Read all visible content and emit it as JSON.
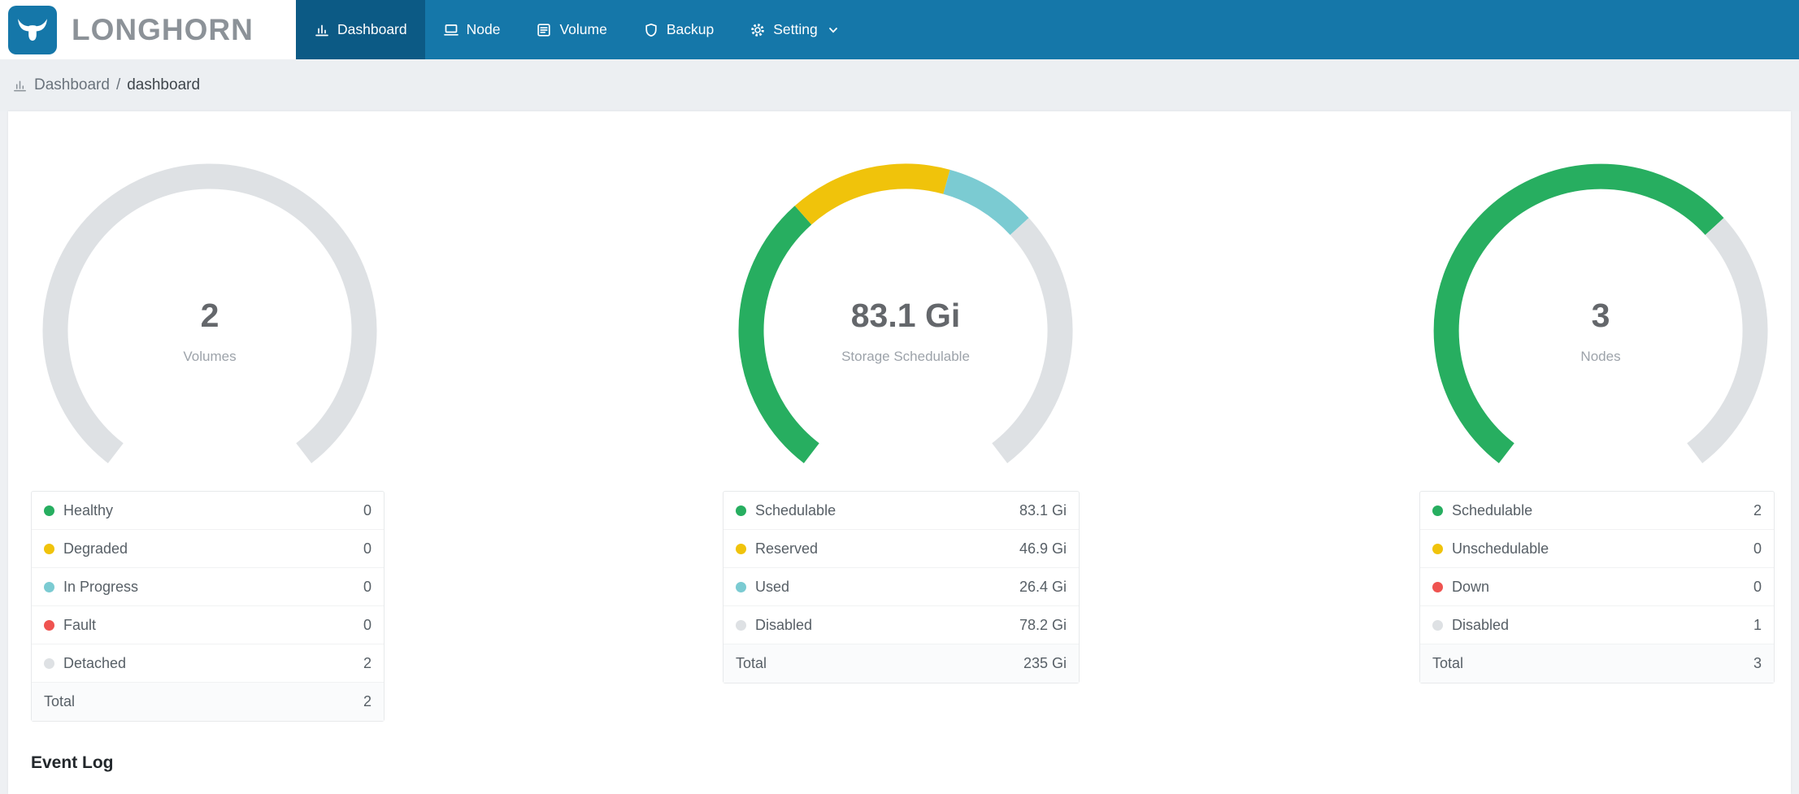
{
  "brand": {
    "name": "LONGHORN"
  },
  "colors": {
    "navbar": "#1577A9",
    "navbar_active": "#0C5A85",
    "green": "#27AE60",
    "yellow": "#F0C30B",
    "cyan": "#7BCBD2",
    "red": "#EF5350",
    "gray": "#DEE1E4"
  },
  "nav": {
    "items": [
      {
        "label": "Dashboard",
        "icon": "dashboard-icon",
        "active": true
      },
      {
        "label": "Node",
        "icon": "node-icon",
        "active": false
      },
      {
        "label": "Volume",
        "icon": "volume-icon",
        "active": false
      },
      {
        "label": "Backup",
        "icon": "backup-icon",
        "active": false
      },
      {
        "label": "Setting",
        "icon": "setting-icon",
        "active": false,
        "has_dropdown": true
      }
    ]
  },
  "breadcrumb": {
    "root": "Dashboard",
    "separator": "/",
    "current": "dashboard"
  },
  "chart_data": [
    {
      "type": "gauge",
      "title": "Volumes",
      "center_value": "2",
      "center_label": "Volumes",
      "arc_degrees": 285,
      "total": 2,
      "segments": [
        {
          "label": "Healthy",
          "value": 0,
          "color": "green"
        },
        {
          "label": "Degraded",
          "value": 0,
          "color": "yellow"
        },
        {
          "label": "In Progress",
          "value": 0,
          "color": "cyan"
        },
        {
          "label": "Fault",
          "value": 0,
          "color": "red"
        },
        {
          "label": "Detached",
          "value": 2,
          "color": "gray"
        }
      ]
    },
    {
      "type": "gauge",
      "title": "Storage Schedulable",
      "center_value": "83.1 Gi",
      "center_label": "Storage Schedulable",
      "arc_degrees": 285,
      "total": 235,
      "segments": [
        {
          "label": "Schedulable",
          "value": 83.1,
          "color": "green"
        },
        {
          "label": "Reserved",
          "value": 46.9,
          "color": "yellow"
        },
        {
          "label": "Used",
          "value": 26.4,
          "color": "cyan"
        },
        {
          "label": "Disabled",
          "value": 78.2,
          "color": "gray"
        }
      ]
    },
    {
      "type": "gauge",
      "title": "Nodes",
      "center_value": "3",
      "center_label": "Nodes",
      "arc_degrees": 285,
      "total": 3,
      "segments": [
        {
          "label": "Schedulable",
          "value": 2,
          "color": "green"
        },
        {
          "label": "Unschedulable",
          "value": 0,
          "color": "yellow"
        },
        {
          "label": "Down",
          "value": 0,
          "color": "red"
        },
        {
          "label": "Disabled",
          "value": 1,
          "color": "gray"
        }
      ]
    }
  ],
  "cards": [
    {
      "rows": [
        {
          "label": "Healthy",
          "value": "0"
        },
        {
          "label": "Degraded",
          "value": "0"
        },
        {
          "label": "In Progress",
          "value": "0"
        },
        {
          "label": "Fault",
          "value": "0"
        },
        {
          "label": "Detached",
          "value": "2"
        }
      ],
      "total_label": "Total",
      "total_value": "2"
    },
    {
      "rows": [
        {
          "label": "Schedulable",
          "value": "83.1 Gi"
        },
        {
          "label": "Reserved",
          "value": "46.9 Gi"
        },
        {
          "label": "Used",
          "value": "26.4 Gi"
        },
        {
          "label": "Disabled",
          "value": "78.2 Gi"
        }
      ],
      "total_label": "Total",
      "total_value": "235 Gi"
    },
    {
      "rows": [
        {
          "label": "Schedulable",
          "value": "2"
        },
        {
          "label": "Unschedulable",
          "value": "0"
        },
        {
          "label": "Down",
          "value": "0"
        },
        {
          "label": "Disabled",
          "value": "1"
        }
      ],
      "total_label": "Total",
      "total_value": "3"
    }
  ],
  "sections": {
    "event_log_title": "Event Log"
  }
}
